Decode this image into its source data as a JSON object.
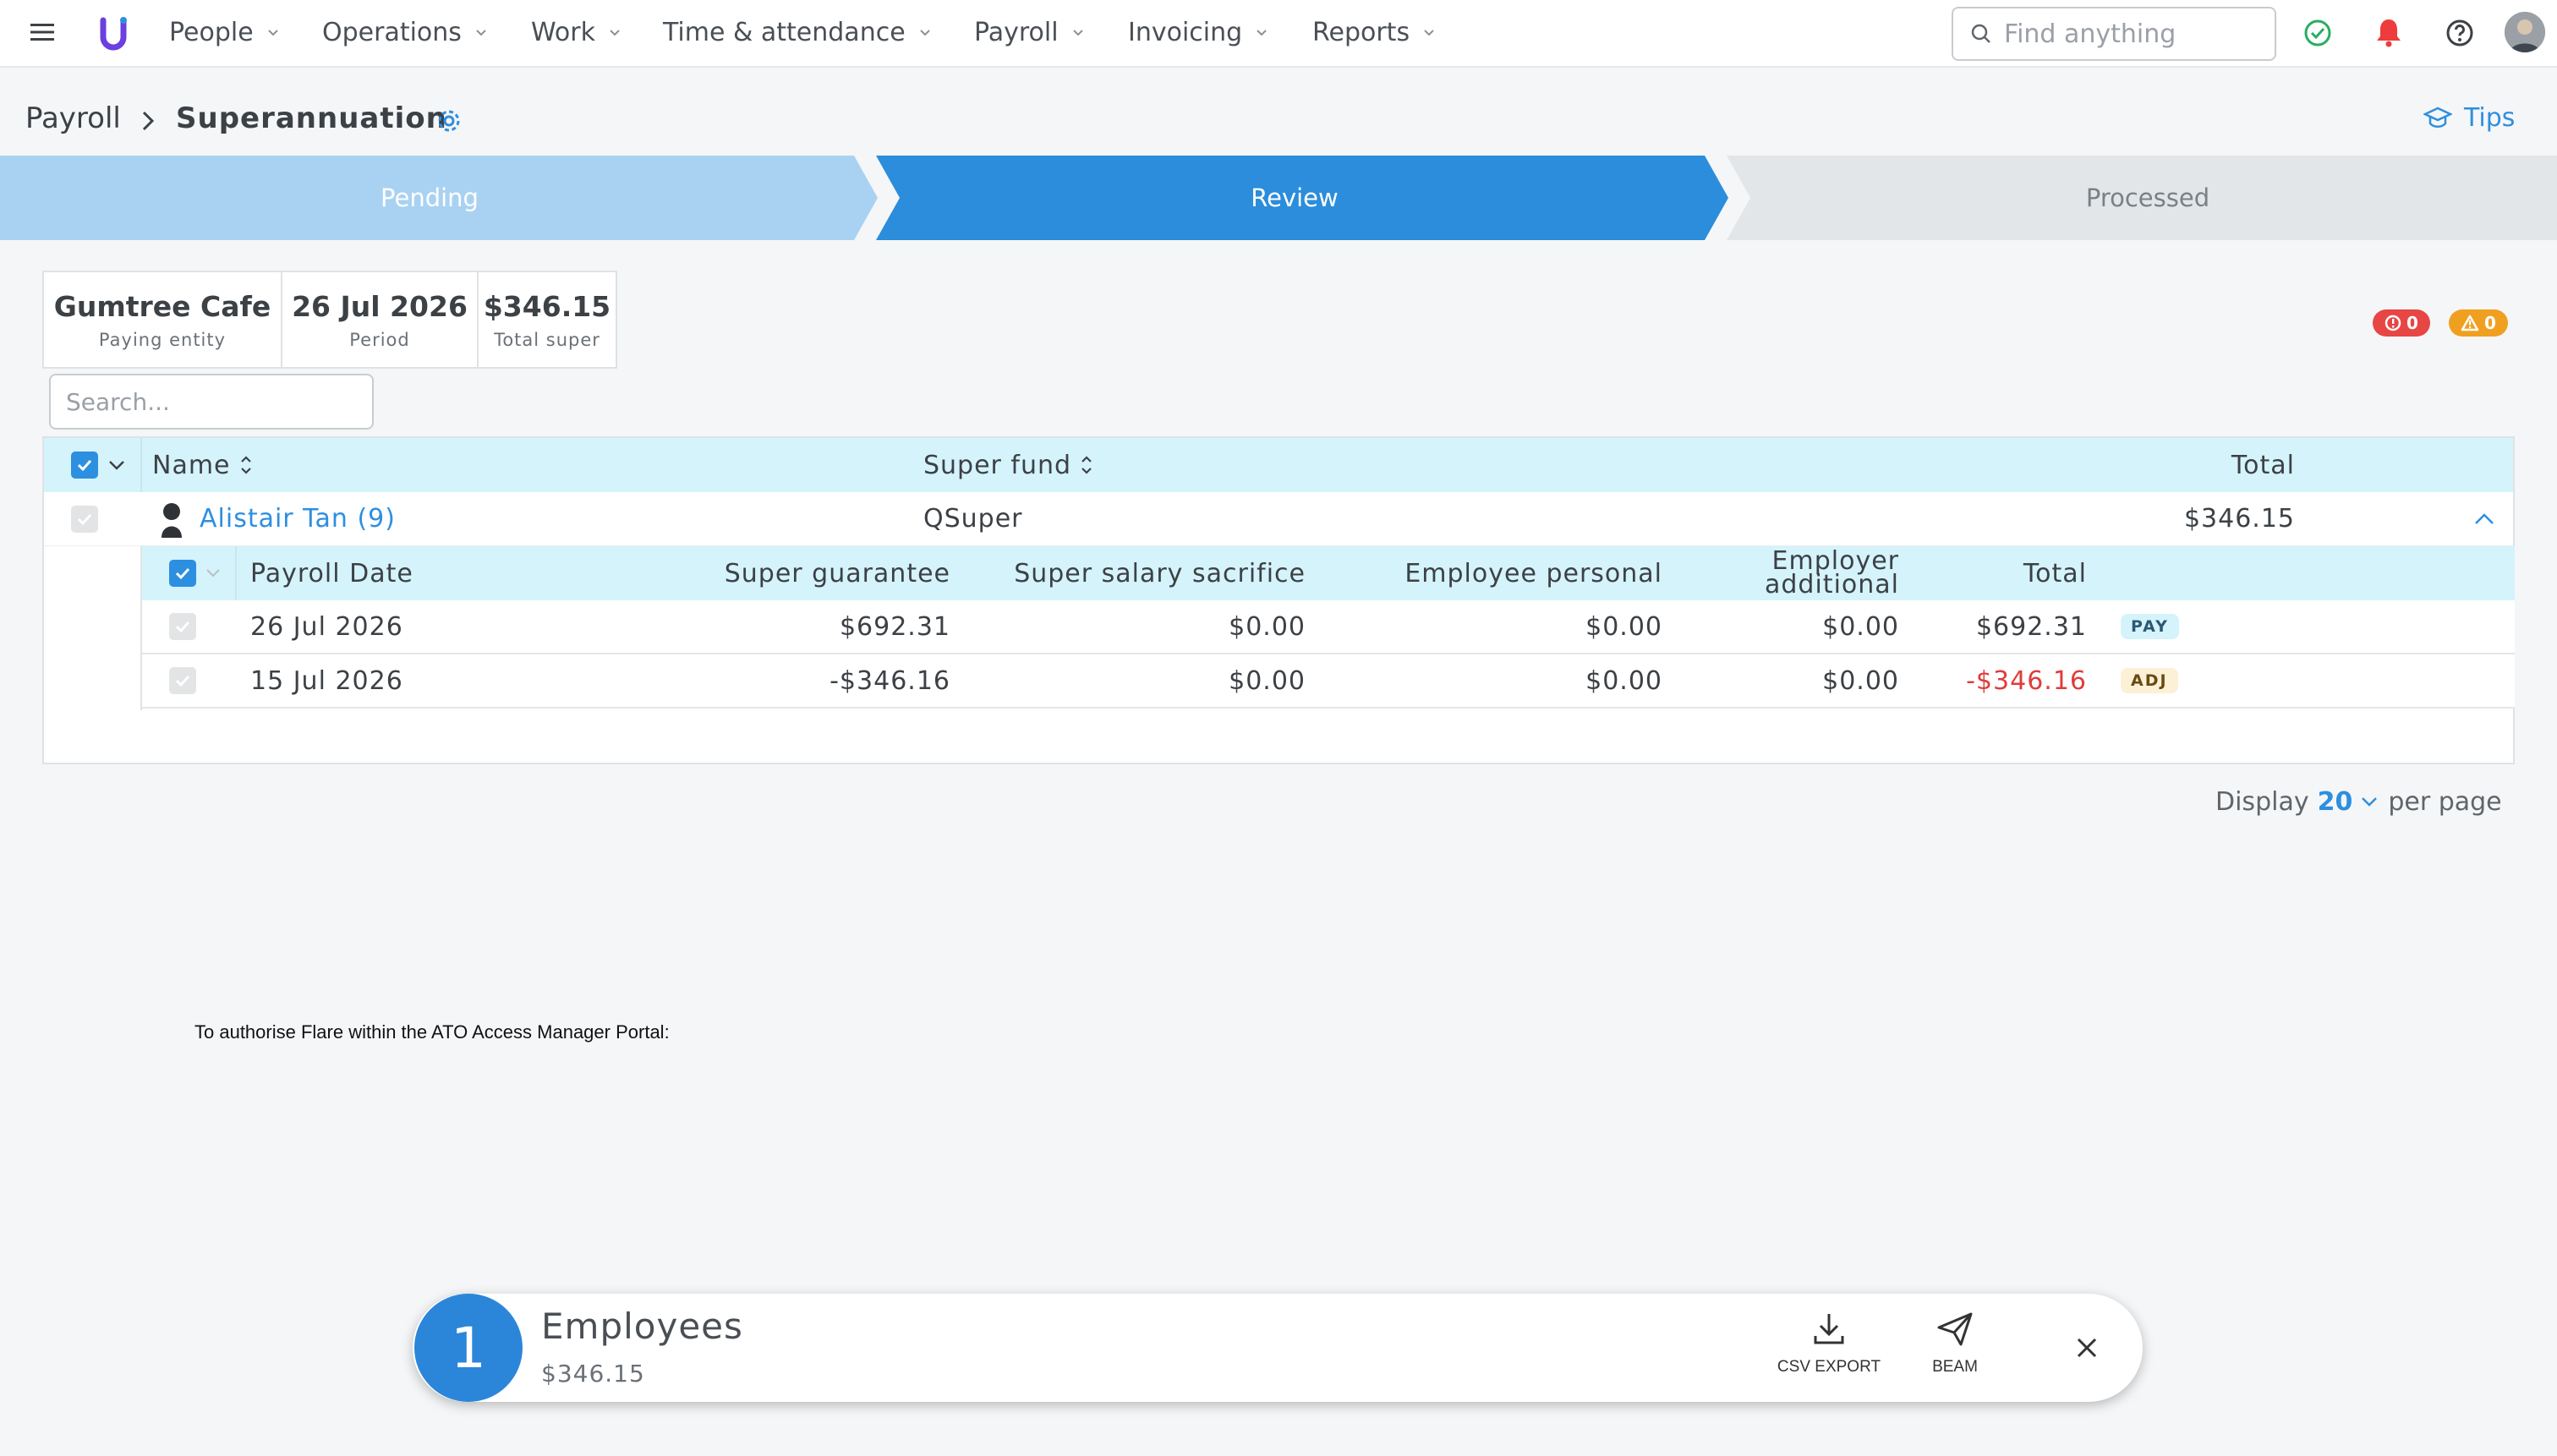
{
  "nav": {
    "items": [
      {
        "label": "People"
      },
      {
        "label": "Operations"
      },
      {
        "label": "Work"
      },
      {
        "label": "Time & attendance"
      },
      {
        "label": "Payroll"
      },
      {
        "label": "Invoicing"
      },
      {
        "label": "Reports"
      }
    ],
    "search_placeholder": "Find anything"
  },
  "breadcrumb": {
    "parent": "Payroll",
    "current": "Superannuation",
    "tips_label": "Tips"
  },
  "steps": [
    {
      "label": "Pending",
      "state": "done"
    },
    {
      "label": "Review",
      "state": "active"
    },
    {
      "label": "Processed",
      "state": "todo"
    }
  ],
  "summary": {
    "entity": {
      "value": "Gumtree Cafe",
      "label": "Paying entity"
    },
    "period": {
      "value": "26 Jul 2026",
      "label": "Period"
    },
    "total": {
      "value": "$346.15",
      "label": "Total super"
    }
  },
  "badges": {
    "errors": "0",
    "warnings": "0"
  },
  "list_search_placeholder": "Search...",
  "table": {
    "headers": {
      "name": "Name",
      "super_fund": "Super fund",
      "total": "Total"
    },
    "employee": {
      "name": "Alistair Tan (9)",
      "fund": "QSuper",
      "total": "$346.15"
    },
    "sub_headers": {
      "payroll_date": "Payroll Date",
      "super_guarantee": "Super guarantee",
      "salary_sacrifice": "Super salary sacrifice",
      "employee_personal": "Employee personal",
      "employer_additional_1": "Employer",
      "employer_additional_2": "additional",
      "total": "Total"
    },
    "rows": [
      {
        "date": "26 Jul 2026",
        "guarantee": "$692.31",
        "sacrifice": "$0.00",
        "personal": "$0.00",
        "additional": "$0.00",
        "total": "$692.31",
        "tag": "PAY"
      },
      {
        "date": "15 Jul 2026",
        "guarantee": "-$346.16",
        "sacrifice": "$0.00",
        "personal": "$0.00",
        "additional": "$0.00",
        "total": "-$346.16",
        "tag": "ADJ"
      }
    ]
  },
  "pager": {
    "prefix": "Display",
    "value": "20",
    "suffix": "per page"
  },
  "ato_note": "To authorise Flare within the ATO Access Manager Portal:",
  "action_bar": {
    "count": "1",
    "title": "Employees",
    "amount": "$346.15",
    "csv_label": "CSV EXPORT",
    "beam_label": "BEAM"
  },
  "colors": {
    "accent": "#2d8fe0",
    "step_done": "#a9d2f2",
    "step_active": "#2b8ddb",
    "step_todo": "#e3e6e9",
    "error": "#e84545",
    "warning": "#f0a020",
    "negative": "#e03c3c"
  }
}
